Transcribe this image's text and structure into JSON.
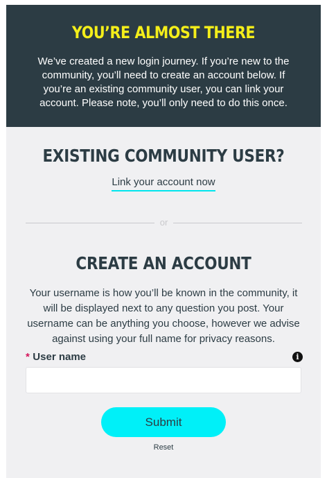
{
  "banner": {
    "title": "YOU’RE ALMOST THERE",
    "text": "We’ve created a new login journey. If you’re new to the community, you’ll need to create an account below. If you’re an existing community user, you can link your account. Please note, you’ll only need to do this once."
  },
  "existing": {
    "title": "EXISTING COMMUNITY USER?",
    "link_label": "Link your account now"
  },
  "divider": {
    "text": "or"
  },
  "create": {
    "title": "CREATE AN ACCOUNT",
    "description": "Your username is how you’ll be known in the community, it will be displayed next to any question you post. Your username can be anything you choose, however we advise against using your full name for privacy reasons."
  },
  "form": {
    "required_marker": "*",
    "username_label": "User name",
    "username_value": "",
    "info_icon_glyph": "i",
    "submit_label": "Submit",
    "reset_label": "Reset"
  },
  "colors": {
    "banner_bg": "#2c3c44",
    "banner_title": "#f4ee1a",
    "accent": "#00f0f8",
    "required": "#d4145a",
    "panel_bg": "#f0f0f2"
  }
}
